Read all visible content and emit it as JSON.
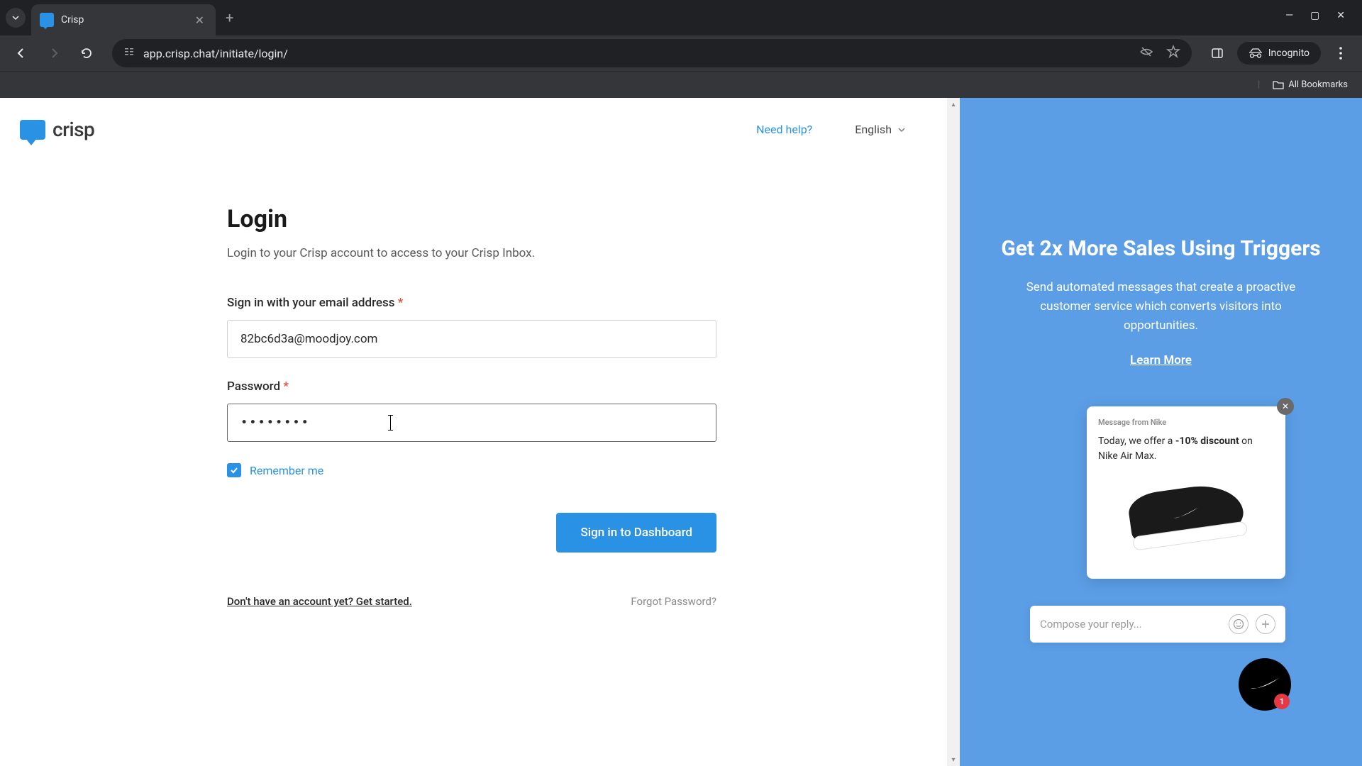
{
  "browser": {
    "tab_title": "Crisp",
    "url": "app.crisp.chat/initiate/login/",
    "incognito_label": "Incognito",
    "bookmarks_label": "All Bookmarks"
  },
  "header": {
    "brand": "crisp",
    "need_help": "Need help?",
    "language": "English"
  },
  "login": {
    "title": "Login",
    "subtitle": "Login to your Crisp account to access to your Crisp Inbox.",
    "email_label": "Sign in with your email address",
    "email_value": "82bc6d3a@moodjoy.com",
    "password_label": "Password",
    "password_value": "••••••••",
    "remember_label": "Remember me",
    "signin_button": "Sign in to Dashboard",
    "signup_link": "Don't have an account yet? Get started.",
    "forgot_link": "Forgot Password?"
  },
  "promo": {
    "title": "Get 2x More Sales Using Triggers",
    "body": "Send automated messages that create a proactive customer service which converts visitors into opportunities.",
    "learn_more": "Learn More",
    "chat": {
      "from": "Message from Nike",
      "line1": "Today, we offer a ",
      "discount": "-10% discount",
      "line2": " on Nike Air Max.",
      "compose_placeholder": "Compose your reply...",
      "badge": "1"
    }
  }
}
